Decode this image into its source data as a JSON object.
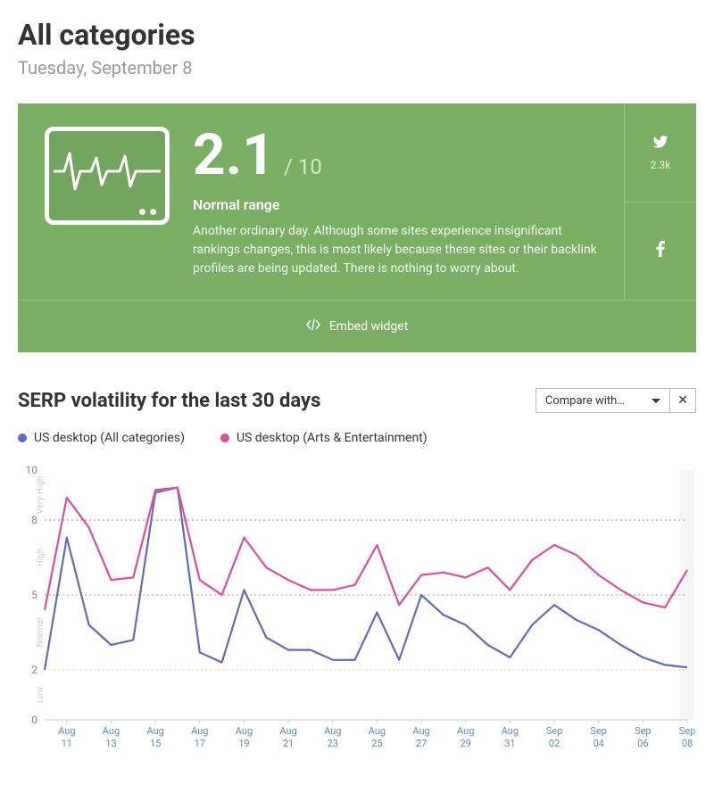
{
  "header": {
    "title": "All categories",
    "date": "Tuesday, September 8"
  },
  "sensor": {
    "score": "2.1",
    "max": "/ 10",
    "status": "Normal range",
    "description": "Another ordinary day. Although some sites experience insignificant rankings changes, this is most likely because these sites or their backlink profiles are being updated. There is nothing to worry about.",
    "twitter_count": "2.3k",
    "embed_label": "Embed widget"
  },
  "chart": {
    "title": "SERP volatility for the last 30 days",
    "compare_label": "Compare with…",
    "close_symbol": "✕",
    "legend": {
      "series1": "US desktop (All categories)",
      "series2": "US desktop (Arts & Entertainment)"
    },
    "bands": {
      "low": "Low",
      "normal": "Normal",
      "high": "High",
      "veryhigh": "Very High"
    }
  },
  "chart_data": {
    "type": "line",
    "title": "SERP volatility for the last 30 days",
    "ylabel": "",
    "xlabel": "",
    "ylim": [
      0,
      10
    ],
    "yticks": [
      0,
      2,
      5,
      8,
      10
    ],
    "bands": [
      {
        "label": "Low",
        "from": 0,
        "to": 2,
        "color": "#6bbf6b"
      },
      {
        "label": "Normal",
        "from": 2,
        "to": 5,
        "color": "#e9b85a"
      },
      {
        "label": "High",
        "from": 5,
        "to": 8,
        "color": "#d65a5a"
      },
      {
        "label": "Very High",
        "from": 8,
        "to": 10,
        "color": "#b34040"
      }
    ],
    "categories": [
      "Aug 10",
      "Aug 11",
      "Aug 12",
      "Aug 13",
      "Aug 14",
      "Aug 15",
      "Aug 16",
      "Aug 17",
      "Aug 18",
      "Aug 19",
      "Aug 20",
      "Aug 21",
      "Aug 22",
      "Aug 23",
      "Aug 24",
      "Aug 25",
      "Aug 26",
      "Aug 27",
      "Aug 28",
      "Aug 29",
      "Aug 30",
      "Aug 31",
      "Sep 01",
      "Sep 02",
      "Sep 03",
      "Sep 04",
      "Sep 05",
      "Sep 06",
      "Sep 07",
      "Sep 08"
    ],
    "xticks": [
      "Aug 11",
      "Aug 13",
      "Aug 15",
      "Aug 17",
      "Aug 19",
      "Aug 21",
      "Aug 23",
      "Aug 25",
      "Aug 27",
      "Aug 29",
      "Aug 31",
      "Sep 02",
      "Sep 04",
      "Sep 06",
      "Sep 08"
    ],
    "series": [
      {
        "name": "US desktop (All categories)",
        "color": "#5c6cc0",
        "values": [
          2.0,
          7.3,
          3.8,
          3.0,
          3.2,
          9.1,
          9.3,
          2.7,
          2.3,
          5.2,
          3.3,
          2.8,
          2.8,
          2.4,
          2.4,
          4.3,
          2.4,
          5.0,
          4.2,
          3.8,
          3.0,
          2.5,
          3.8,
          4.6,
          4.0,
          3.6,
          3.0,
          2.5,
          2.2,
          2.1
        ]
      },
      {
        "name": "US desktop (Arts & Entertainment)",
        "color": "#e04c9a",
        "values": [
          4.4,
          8.9,
          7.7,
          5.6,
          5.7,
          9.2,
          9.3,
          5.6,
          5.0,
          7.3,
          6.1,
          5.6,
          5.2,
          5.2,
          5.4,
          7.0,
          4.6,
          5.8,
          5.9,
          5.7,
          6.1,
          5.2,
          6.4,
          7.0,
          6.6,
          5.8,
          5.2,
          4.7,
          4.5,
          6.0
        ]
      }
    ]
  }
}
